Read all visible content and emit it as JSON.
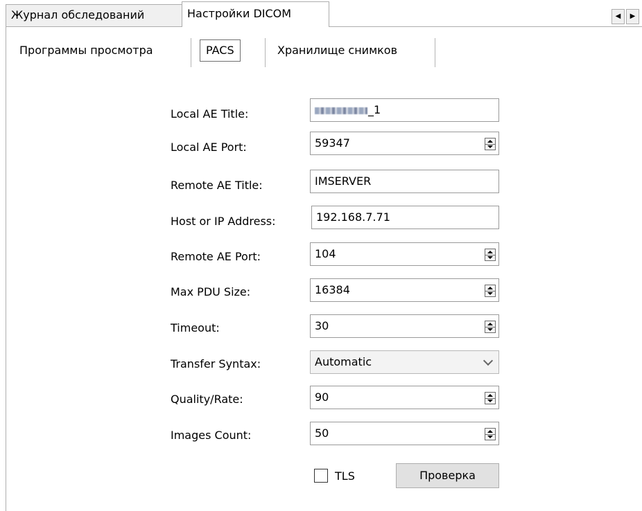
{
  "top_tabs": [
    {
      "label": "Журнал обследований"
    },
    {
      "label": "Настройки DICOM"
    }
  ],
  "sub_tabs": [
    {
      "label": "Программы просмотра"
    },
    {
      "label": "PACS"
    },
    {
      "label": "Хранилище снимков"
    }
  ],
  "form": {
    "local_ae_title": {
      "label": "Local AE Title:",
      "value_suffix": "_1"
    },
    "local_ae_port": {
      "label": "Local AE Port:",
      "value": "59347"
    },
    "remote_ae_title": {
      "label": "Remote AE Title:",
      "value": "IMSERVER"
    },
    "host": {
      "label": "Host or IP Address:",
      "value": "192.168.7.71"
    },
    "remote_ae_port": {
      "label": "Remote AE Port:",
      "value": "104"
    },
    "max_pdu": {
      "label": "Max PDU Size:",
      "value": "16384"
    },
    "timeout": {
      "label": "Timeout:",
      "value": "30"
    },
    "transfer_syntax": {
      "label": "Transfer Syntax:",
      "value": "Automatic"
    },
    "quality": {
      "label": "Quality/Rate:",
      "value": "90"
    },
    "images_count": {
      "label": "Images Count:",
      "value": "50"
    },
    "tls_label": "TLS",
    "check_button": "Проверка"
  },
  "icons": {
    "scroll_left": "triangle-left",
    "scroll_right": "triangle-right",
    "spinner": "up-down-arrows",
    "dropdown": "chevron-down"
  }
}
